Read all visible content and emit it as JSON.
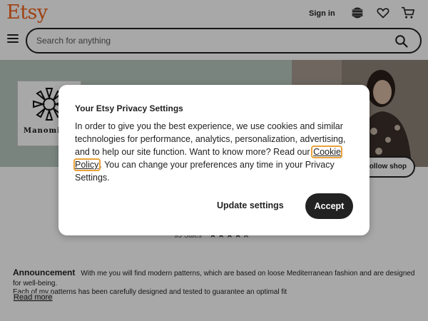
{
  "header": {
    "logo": "Etsy",
    "signin_label": "Sign in"
  },
  "search": {
    "placeholder": "Search for anything"
  },
  "shop": {
    "logo_text": "Manomi",
    "follow_label": "Follow shop",
    "sales": "93 Sales",
    "rating_stars": "★★★★✯",
    "rating": 4.5
  },
  "announcement": {
    "heading": "Announcement",
    "text": "With me you will find modern patterns, which are based on loose Mediterranean fashion and are designed for well-being.",
    "text2": "Each of my patterns has been carefully designed and tested to guarantee an optimal fit",
    "read_more": "Read more"
  },
  "privacy_modal": {
    "title": "Your Etsy Privacy Settings",
    "body_before": "In order to give you the best experience, we use cookies and similar technologies for performance, analytics, personalization, advertising, and to help our site function. Want to know more? Read our ",
    "link": "Cookie Policy",
    "body_after": ". You can change your preferences any time in your Privacy Settings.",
    "update_label": "Update settings",
    "accept_label": "Accept"
  },
  "colors": {
    "brand": "#f1641e",
    "banner": "#b9c9c0",
    "focus_outline": "#e9a23b",
    "button_dark": "#222222"
  }
}
